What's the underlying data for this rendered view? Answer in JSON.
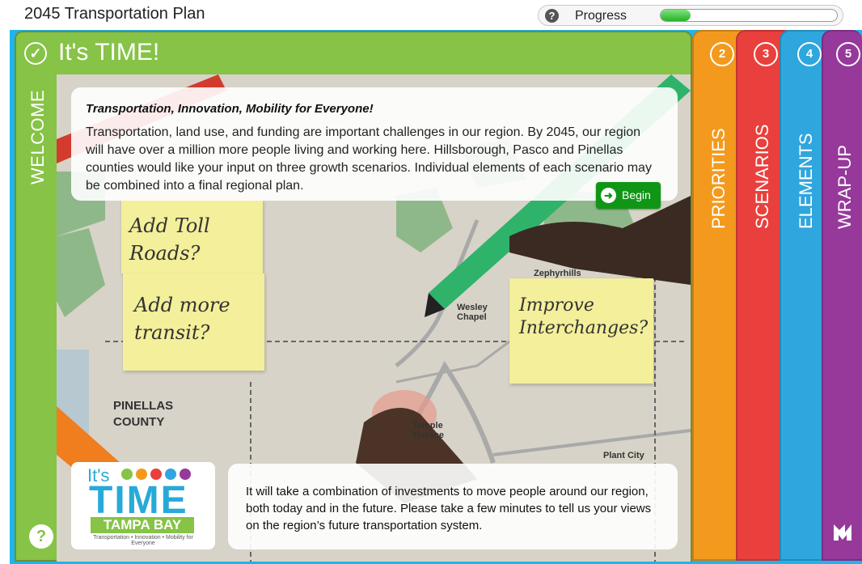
{
  "header": {
    "title": "2045 Transportation Plan",
    "help_icon": "help-icon",
    "progress_label": "Progress",
    "progress_value": 0.17
  },
  "welcome": {
    "heading": "It's TIME!",
    "vertical_label": "WELCOME",
    "check_icon": "check-circle-icon",
    "help_icon": "help-circle-icon"
  },
  "tabs": [
    {
      "number": "2",
      "label": "PRIORITIES",
      "color": "#f39a1e"
    },
    {
      "number": "3",
      "label": "SCENARIOS",
      "color": "#e9403d"
    },
    {
      "number": "4",
      "label": "ELEMENTS",
      "color": "#2fa6de"
    },
    {
      "number": "5",
      "label": "WRAP-UP",
      "color": "#96399b"
    }
  ],
  "intro": {
    "heading": "Transportation, Innovation, Mobility for Everyone!",
    "body": "Transportation, land use, and funding are important challenges in our region. By 2045, our region will have over a million more people living and working here. Hillsborough, Pasco and Pinellas counties would like your input on three growth scenarios. Individual elements of each scenario may be combined into a final regional plan.",
    "begin_label": "Begin",
    "begin_icon": "arrow-right-circle-icon"
  },
  "bottom_text": "It will take a combination of investments to move people around our region, both today and in the future. Please take a few minutes to tell us your views on the region’s future transportation system.",
  "logo": {
    "its": "It's",
    "time": "TIME",
    "band": "TAMPA BAY",
    "tagline": "Transportation • Innovation • Mobility for Everyone"
  },
  "map": {
    "notes": [
      "Add Toll Roads?",
      "Add more transit?",
      "Improve Interchanges?"
    ],
    "labels": [
      "PINELLAS COUNTY",
      "Zephyrhills",
      "Wesley Chapel",
      "Temple Terrace",
      "Plant City"
    ]
  },
  "brand_icon": "brand-logo-icon"
}
